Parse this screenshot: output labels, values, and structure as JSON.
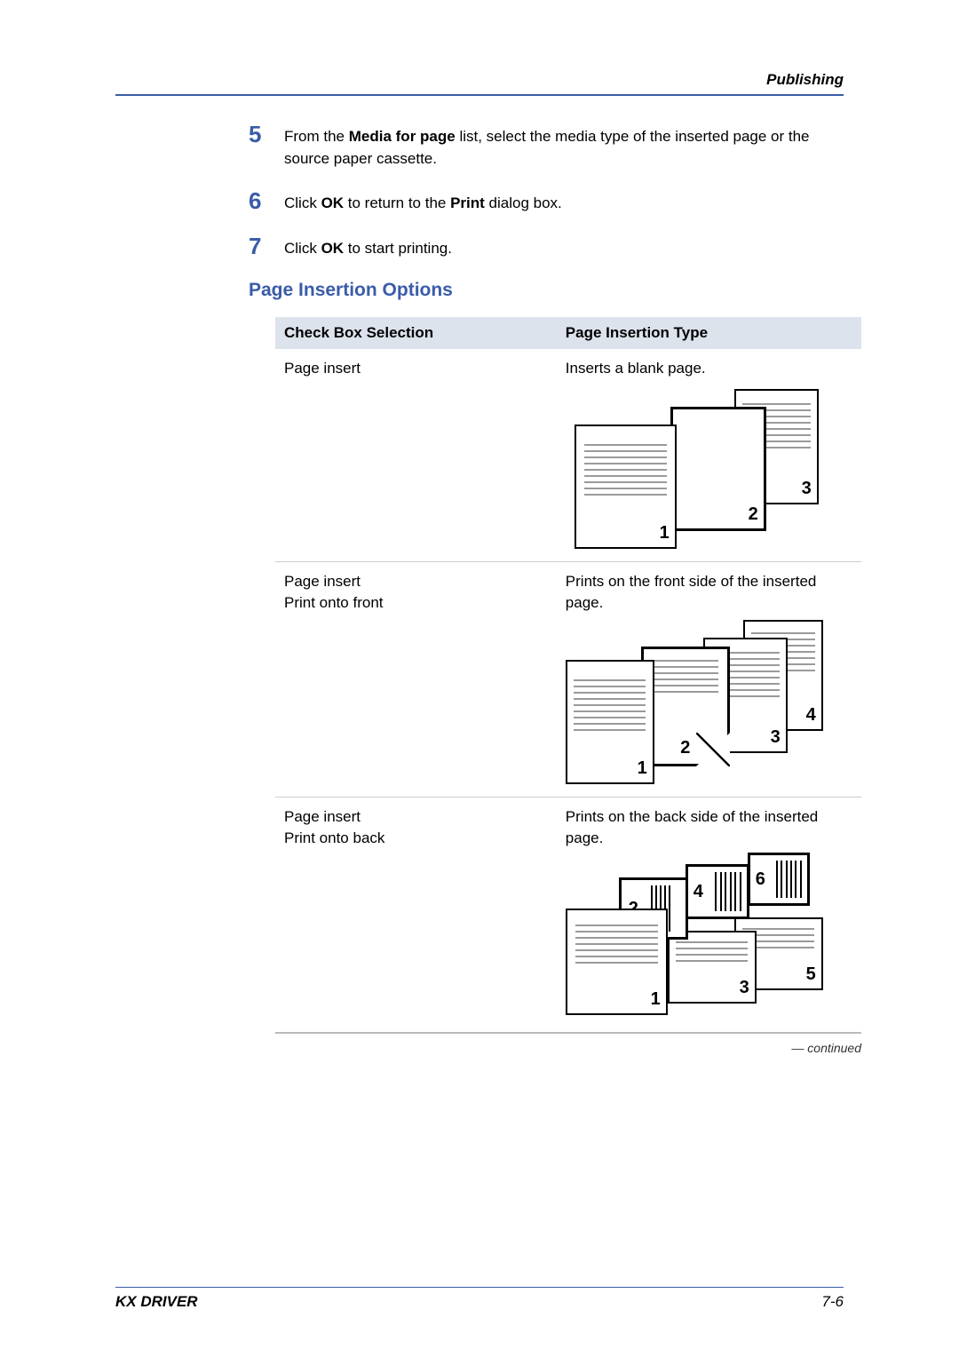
{
  "header": {
    "section": "Publishing"
  },
  "steps": [
    {
      "num": "5",
      "text_parts": [
        "From the ",
        "Media for page",
        " list, select the media type of the inserted page or the source paper cassette."
      ],
      "bold_indices": [
        1
      ]
    },
    {
      "num": "6",
      "text_parts": [
        "Click ",
        "OK",
        " to return to the ",
        "Print",
        " dialog box."
      ],
      "bold_indices": [
        1,
        3
      ]
    },
    {
      "num": "7",
      "text_parts": [
        "Click ",
        "OK",
        " to start printing."
      ],
      "bold_indices": [
        1
      ]
    }
  ],
  "section_heading": "Page Insertion Options",
  "table": {
    "headers": [
      "Check Box Selection",
      "Page Insertion Type"
    ],
    "rows": [
      {
        "selection_lines": [
          "Page insert"
        ],
        "description": "Inserts a blank page.",
        "diagram": "blank",
        "diagram_labels": [
          "1",
          "2",
          "3"
        ]
      },
      {
        "selection_lines": [
          "Page insert",
          "Print onto front"
        ],
        "description": "Prints on the front side of the inserted page.",
        "diagram": "front",
        "diagram_labels": [
          "1",
          "2",
          "3",
          "4"
        ]
      },
      {
        "selection_lines": [
          "Page insert",
          "Print onto back"
        ],
        "description": "Prints on the back side of the inserted page.",
        "diagram": "back",
        "diagram_labels": [
          "1",
          "2",
          "3",
          "4",
          "5",
          "6"
        ]
      }
    ]
  },
  "continued": "— continued",
  "footer": {
    "left": "KX DRIVER",
    "right": "7-6"
  }
}
